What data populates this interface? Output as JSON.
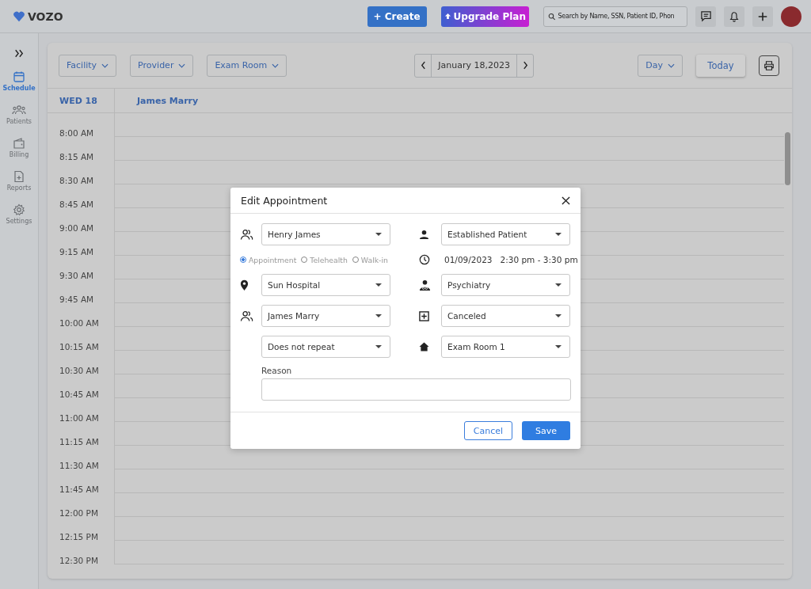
{
  "brand": "VOZO",
  "topbar": {
    "create": "+ Create",
    "upgrade": "Upgrade Plan",
    "search_placeholder": "Search by Name, SSN, Patient ID, Phon"
  },
  "sidebar": [
    {
      "label": "Schedule",
      "selected": true
    },
    {
      "label": "Patients",
      "selected": false
    },
    {
      "label": "Billing",
      "selected": false
    },
    {
      "label": "Reports",
      "selected": false
    },
    {
      "label": "Settings",
      "selected": false
    }
  ],
  "filters": [
    "Facility",
    "Provider",
    "Exam Room"
  ],
  "date": "January 18,2023",
  "view": "Day",
  "today": "Today",
  "schedule": {
    "day": "WED 18",
    "provider": "James Marry",
    "times": [
      "8:00 AM",
      "8:15 AM",
      "8:30 AM",
      "8:45 AM",
      "9:00 AM",
      "9:15 AM",
      "9:30 AM",
      "9:45 AM",
      "10:00 AM",
      "10:15 AM",
      "10:30 AM",
      "10:45 AM",
      "11:00 AM",
      "11:15 AM",
      "11:30 AM",
      "11:45 AM",
      "12:00 PM",
      "12:15 PM",
      "12:30 PM"
    ]
  },
  "dialog": {
    "title": "Edit Appointment",
    "patient": "Henry James",
    "patient_type": "Established Patient",
    "visit_types": [
      {
        "label": "Appointment",
        "selected": true
      },
      {
        "label": "Telehealth",
        "selected": false
      },
      {
        "label": "Walk-in",
        "selected": false
      }
    ],
    "date": "01/09/2023",
    "time": "2:30 pm - 3:30 pm",
    "facility": "Sun Hospital",
    "specialty": "Psychiatry",
    "provider": "James Marry",
    "status": "Canceled",
    "repeat": "Does not repeat",
    "room": "Exam Room 1",
    "reason_label": "Reason",
    "buttons": {
      "cancel": "Cancel",
      "save": "Save"
    }
  }
}
